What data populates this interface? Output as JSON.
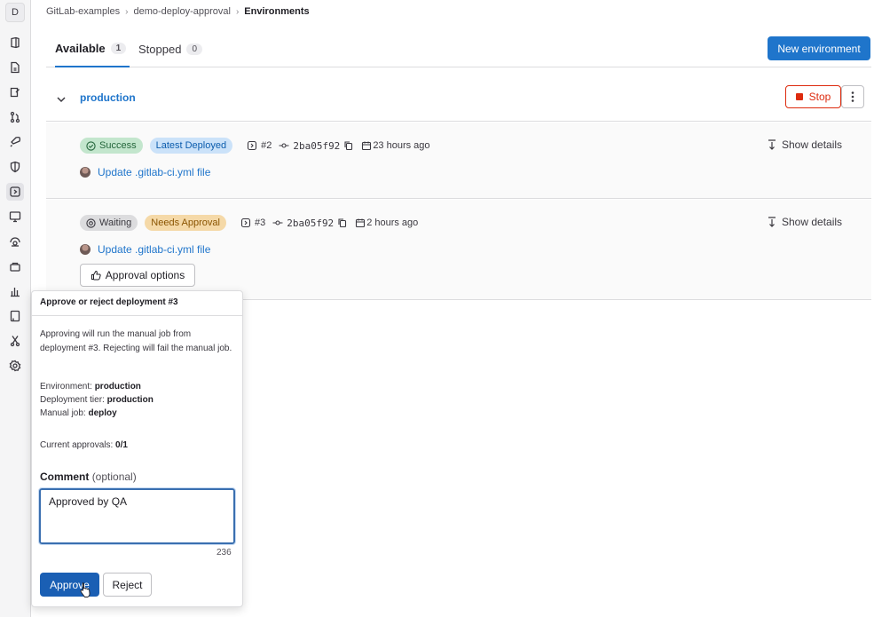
{
  "sidebar": {
    "avatar_letter": "D",
    "items": [
      {
        "icon": "project-icon"
      },
      {
        "icon": "file-icon"
      },
      {
        "icon": "issues-icon"
      },
      {
        "icon": "merge-request-icon"
      },
      {
        "icon": "rocket-icon"
      },
      {
        "icon": "shield-icon"
      },
      {
        "icon": "deployments-icon",
        "active": true
      },
      {
        "icon": "monitor-icon"
      },
      {
        "icon": "infrastructure-icon"
      },
      {
        "icon": "package-icon"
      },
      {
        "icon": "analytics-icon"
      },
      {
        "icon": "wiki-icon"
      },
      {
        "icon": "snippets-icon"
      },
      {
        "icon": "settings-icon"
      }
    ]
  },
  "breadcrumb": {
    "items": [
      "GitLab-examples",
      "demo-deploy-approval"
    ],
    "current": "Environments"
  },
  "tabs": [
    {
      "label": "Available",
      "count": "1",
      "active": true
    },
    {
      "label": "Stopped",
      "count": "0",
      "active": false
    }
  ],
  "new_environment_label": "New environment",
  "environment": {
    "name": "production",
    "stop_label": "Stop"
  },
  "deployments": [
    {
      "status": "Success",
      "badge": "Latest Deployed",
      "id": "#2",
      "sha": "2ba05f92",
      "time": "23 hours ago",
      "show_details": "Show details",
      "commit": "Update .gitlab-ci.yml file"
    },
    {
      "status": "Waiting",
      "badge": "Needs Approval",
      "id": "#3",
      "sha": "2ba05f92",
      "time": "2 hours ago",
      "show_details": "Show details",
      "commit": "Update .gitlab-ci.yml file",
      "approval_options_label": "Approval options"
    }
  ],
  "popover": {
    "title": "Approve or reject deployment #3",
    "description": "Approving will run the manual job from deployment #3. Rejecting will fail the manual job.",
    "environment_label": "Environment:",
    "environment_value": "production",
    "tier_label": "Deployment tier:",
    "tier_value": "production",
    "job_label": "Manual job:",
    "job_value": "deploy",
    "approvals_label": "Current approvals:",
    "approvals_value": "0/1",
    "comment_label": "Comment",
    "comment_optional": "(optional)",
    "comment_value": "Approved by QA",
    "char_count": "236",
    "approve_label": "Approve",
    "reject_label": "Reject"
  },
  "colors": {
    "primary": "#1f75cb",
    "danger": "#dd2b0e",
    "success_bg": "#c3e6cd",
    "warning_bg": "#f5d9a8"
  }
}
